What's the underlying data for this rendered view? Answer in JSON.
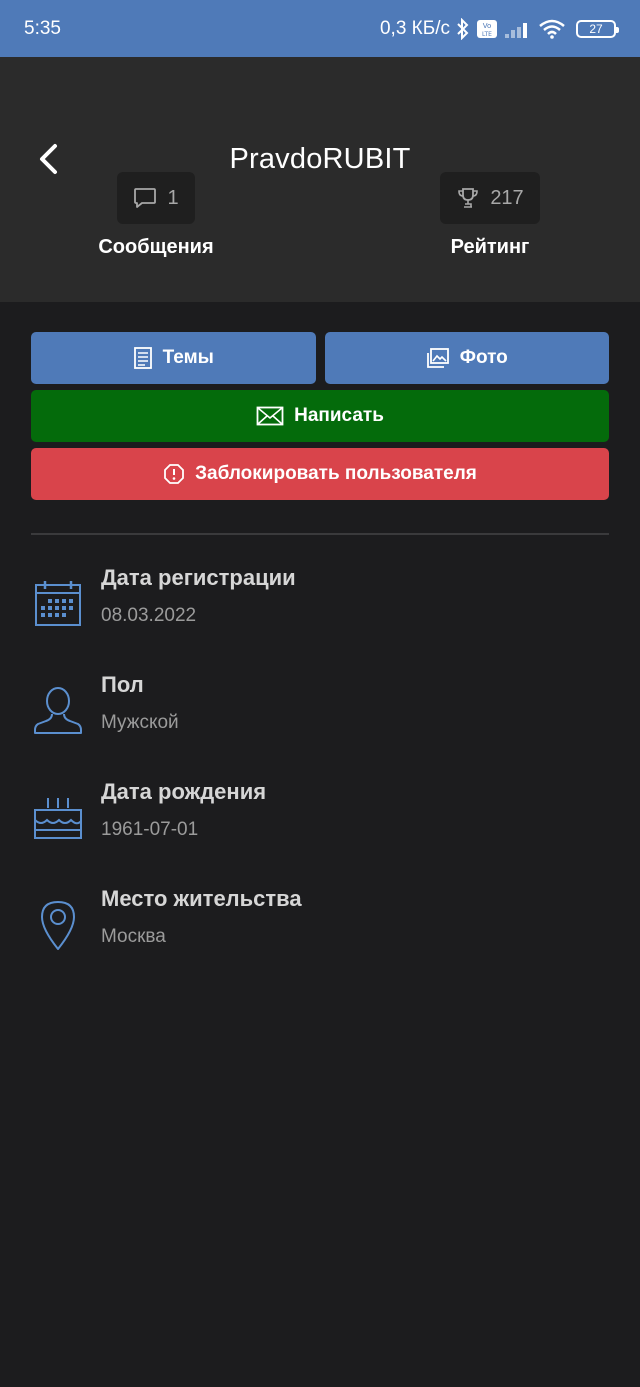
{
  "status_bar": {
    "time": "5:35",
    "network_speed": "0,3 КБ/с",
    "battery_level": "27",
    "icons": [
      "bluetooth-icon",
      "volte-icon",
      "signal-icon",
      "wifi-icon",
      "battery-icon"
    ]
  },
  "header": {
    "title": "PravdoRUBIT",
    "back_icon": "chevron-left-icon",
    "stats": [
      {
        "icon": "message-icon",
        "value": "1",
        "label": "Сообщения"
      },
      {
        "icon": "trophy-icon",
        "value": "217",
        "label": "Рейтинг"
      }
    ]
  },
  "actions": {
    "topics_label": "Темы",
    "photos_label": "Фото",
    "write_label": "Написать",
    "block_label": "Заблокировать пользователя"
  },
  "info": [
    {
      "icon": "calendar-icon",
      "label": "Дата регистрации",
      "value": "08.03.2022"
    },
    {
      "icon": "user-icon",
      "label": "Пол",
      "value": "Мужской"
    },
    {
      "icon": "cake-icon",
      "label": "Дата рождения",
      "value": "1961-07-01"
    },
    {
      "icon": "location-icon",
      "label": "Место жительства",
      "value": "Москва"
    }
  ],
  "colors": {
    "accent_blue": "#4f7ab8",
    "write_green": "#046b0b",
    "block_red": "#d9444b",
    "background": "#1c1c1e",
    "header_bg": "#2b2b2b",
    "icon_blue": "#5b8fcf"
  }
}
